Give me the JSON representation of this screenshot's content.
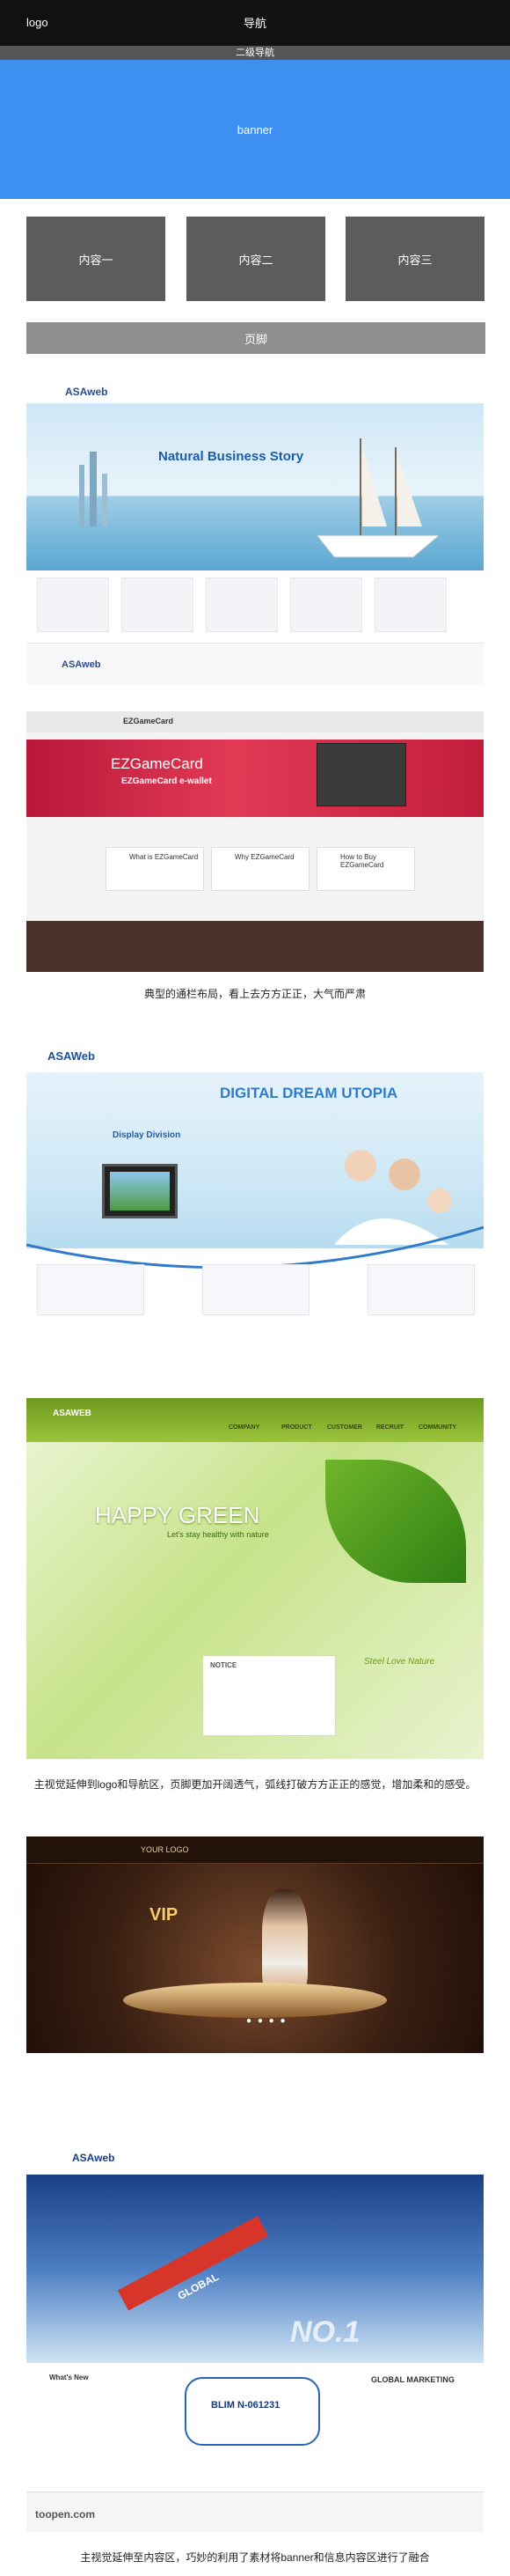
{
  "wireframe": {
    "logo": "logo",
    "nav": "导航",
    "sub_nav": "二级导航",
    "banner": "banner",
    "content_boxes": [
      "内容一",
      "内容二",
      "内容三"
    ],
    "footer": "页脚"
  },
  "example1": {
    "brand": "ASAweb",
    "hero_title": "Natural Business Story",
    "footer_brand": "ASAweb"
  },
  "caption1": "典型的通栏布局，看上去方方正正，大气而严肃",
  "example2": {
    "brand": "EZGameCard",
    "hero_title": "EZGameCard",
    "hero_sub": "EZGameCard e-wallet",
    "rows": [
      "What is EZGameCard",
      "Why EZGameCard",
      "How to Buy EZGameCard"
    ]
  },
  "example3": {
    "brand": "ASAWeb",
    "headline": "DIGITAL DREAM UTOPIA",
    "division": "Display Division"
  },
  "example4": {
    "brand": "ASAWEB",
    "menu": [
      "COMPANY",
      "PRODUCT",
      "CUSTOMER",
      "RECRUIT",
      "COMMUNITY"
    ],
    "headline": "HAPPY GREEN",
    "subline": "Let's stay healthy with nature",
    "notice": "NOTICE",
    "tagline": "Steel Love Nature"
  },
  "caption2": "主视觉延伸到logo和导航区，页脚更加开阔透气，弧线打破方方正正的感觉，增加柔和的感受。",
  "example5": {
    "brand": "YOUR LOGO",
    "vip": "VIP",
    "dots": "● ● ● ●"
  },
  "example6": {
    "brand": "ASAweb",
    "arrow_text": "GLOBAL",
    "number": "NO.1",
    "card": "BLIM N-061231",
    "global": "GLOBAL MARKETING",
    "whats_new": "What's New",
    "watermark": "toopen.com"
  },
  "caption3": "主视觉延伸至内容区，巧妙的利用了素材将banner和信息内容区进行了融合"
}
